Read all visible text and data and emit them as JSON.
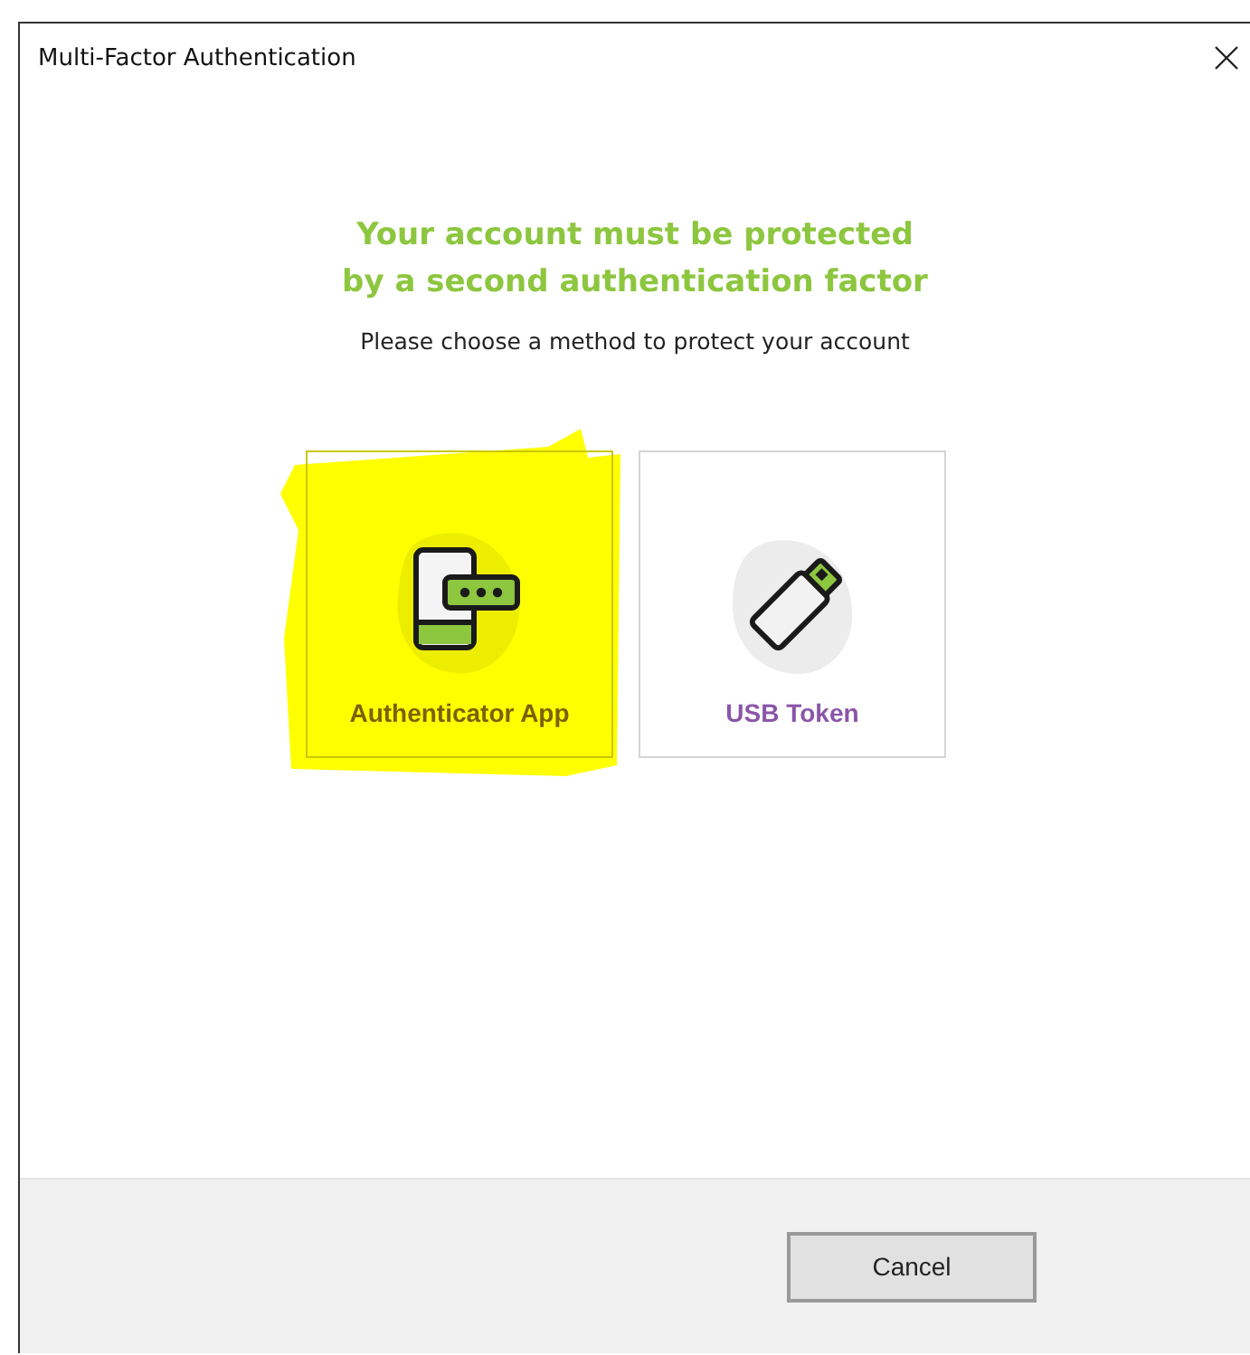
{
  "window": {
    "title": "Multi-Factor Authentication"
  },
  "heading": [
    "Your account must be protected",
    "by a second authentication factor"
  ],
  "instruction": "Please choose a method to protect your account",
  "methods": [
    {
      "kind": "app",
      "label": "Authenticator App",
      "highlighted": true
    },
    {
      "kind": "usb",
      "label": "USB Token",
      "highlighted": false
    }
  ],
  "buttons": [
    "Cancel"
  ]
}
